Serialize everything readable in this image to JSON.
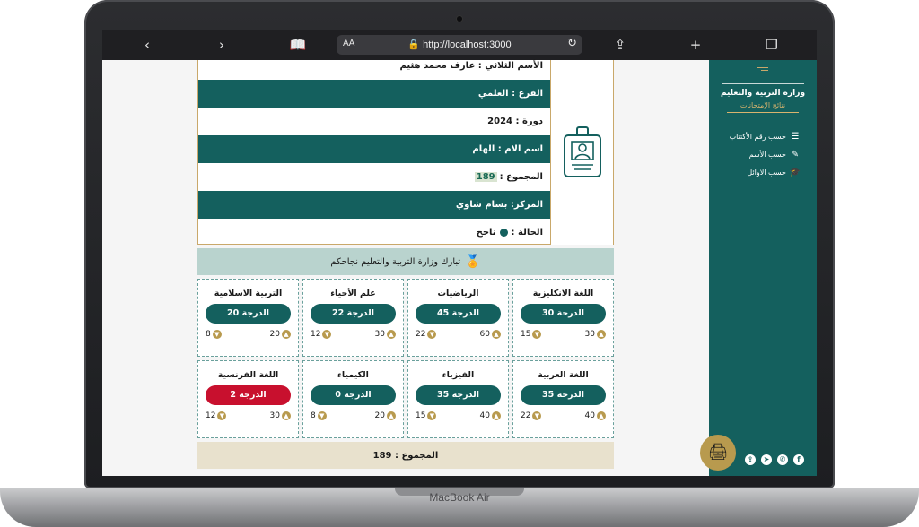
{
  "device": {
    "label": "MacBook Air"
  },
  "browser": {
    "url": "http://localhost:3000",
    "text_size_label": "AA"
  },
  "sidebar": {
    "title": "وزارة التربية والتعليم",
    "subtitle": "نتائج الإمتحانات",
    "items": [
      {
        "label": "حسب رقم الأكتتاب",
        "icon": "list-numbered-icon"
      },
      {
        "label": "حسب الأسم",
        "icon": "pen-icon"
      },
      {
        "label": "حسب الاوائل",
        "icon": "graduation-cap-icon"
      }
    ]
  },
  "student": {
    "name": "الأسم الثلاثي : عارف محمد هثيم",
    "branch": "الفرع : العلمي",
    "session": "دورة : 2024",
    "mother": "اسم الام : الهام",
    "total_label": "المجموع :",
    "total_value": "189",
    "center": "المركز: بسام شاوي",
    "status_label": "الحالة :",
    "status_value": "ناجح"
  },
  "congrats": "تبارك وزارة التربية والتعليم نجاحكم",
  "subjects": [
    {
      "name": "اللغة الانكليزية",
      "grade": "الدرجة 30",
      "max": "30",
      "min": "15",
      "fail": false
    },
    {
      "name": "الرياضيات",
      "grade": "الدرجة 45",
      "max": "60",
      "min": "22",
      "fail": false
    },
    {
      "name": "علم الأحياء",
      "grade": "الدرجة 22",
      "max": "30",
      "min": "12",
      "fail": false
    },
    {
      "name": "التربية الاسلامية",
      "grade": "الدرجة 20",
      "max": "20",
      "min": "8",
      "fail": false
    },
    {
      "name": "اللغة العربية",
      "grade": "الدرجة 35",
      "max": "40",
      "min": "22",
      "fail": false
    },
    {
      "name": "الفيزياء",
      "grade": "الدرجة 35",
      "max": "40",
      "min": "15",
      "fail": false
    },
    {
      "name": "الكيمياء",
      "grade": "الدرجة 0",
      "max": "20",
      "min": "8",
      "fail": false
    },
    {
      "name": "اللغة الفرنسية",
      "grade": "الدرجة 2",
      "max": "30",
      "min": "12",
      "fail": true
    }
  ],
  "total_bar": "المجموع : 189",
  "colors": {
    "primary": "#14605e",
    "gold": "#b89a4e",
    "fail": "#c8102e"
  }
}
